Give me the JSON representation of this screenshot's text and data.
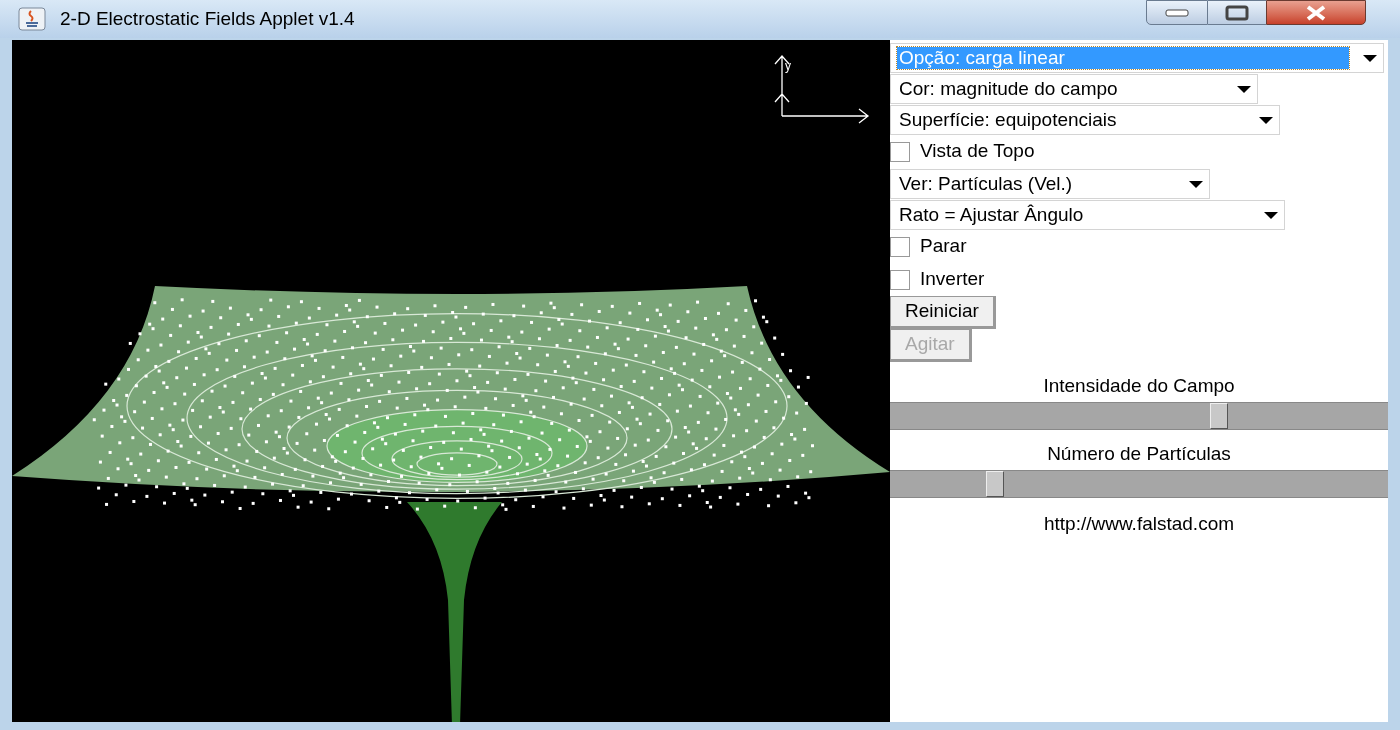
{
  "window": {
    "title": "2-D Electrostatic Fields Applet v1.4"
  },
  "canvas": {
    "axis_label": "y"
  },
  "controls": [
    {
      "kind": "select",
      "label": "Opção: carga linear",
      "focused": true
    },
    {
      "kind": "select",
      "label": "Cor: magnitude do campo",
      "focused": false
    },
    {
      "kind": "select",
      "label": "Superfície: equipotenciais",
      "focused": false
    },
    {
      "kind": "checkbox",
      "label": "Vista de Topo",
      "checked": false
    },
    {
      "kind": "select",
      "label": "Ver: Partículas (Vel.)",
      "focused": false
    },
    {
      "kind": "select",
      "label": "Rato = Ajustar Ângulo",
      "focused": false
    },
    {
      "kind": "checkbox",
      "label": "Parar",
      "checked": false
    },
    {
      "kind": "checkbox",
      "label": "Inverter",
      "checked": false
    },
    {
      "kind": "button",
      "label": "Reiniciar",
      "disabled": false
    },
    {
      "kind": "button",
      "label": "Agitar",
      "disabled": true
    }
  ],
  "sliders": [
    {
      "label": "Intensidade do Campo",
      "level": 0.66
    },
    {
      "label": "Número de Partículas",
      "level": 0.21
    }
  ],
  "footer": "http://www.falstad.com"
}
